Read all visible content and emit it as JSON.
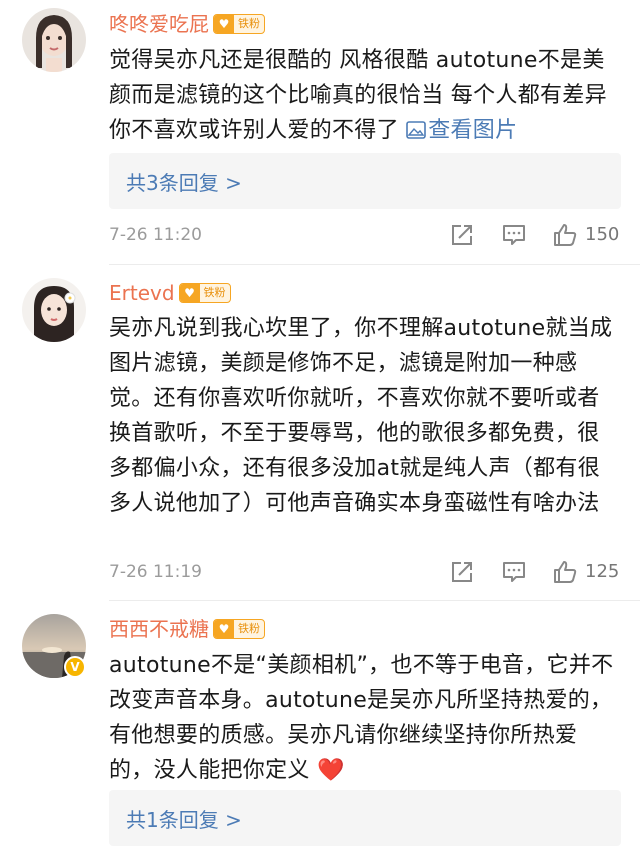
{
  "comments": [
    {
      "username": "咚咚爱吃屁",
      "fan_badge": "铁粉",
      "text": "觉得吴亦凡还是很酷的 风格很酷 autotune不是美颜而是滤镜的这个比喻真的很恰当 每个人都有差异 你不喜欢或许别人爱的不得了 ",
      "view_image": "查看图片",
      "reply_label": "共3条回复 >",
      "timestamp": "7-26 11:20",
      "likes": "150"
    },
    {
      "username": "Ertevd",
      "fan_badge": "铁粉",
      "text": "吴亦凡说到我心坎里了，你不理解autotune就当成图片滤镜，美颜是修饰不足，滤镜是附加一种感觉。还有你喜欢听你就听，不喜欢你就不要听或者换首歌听，不至于要辱骂，他的歌很多都免费，很多都偏小众，还有很多没加at就是纯人声（都有很多人说他加了）可他声音确实本身蛮磁性有啥办法",
      "timestamp": "7-26 11:19",
      "likes": "125"
    },
    {
      "username": "西西不戒糖",
      "fan_badge": "铁粉",
      "text": "autotune不是“美颜相机”，也不等于电音，它并不改变声音本身。autotune是吴亦凡所坚持热爱的，有他想要的质感。吴亦凡请你继续坚持你所热爱的，没人能把你定义",
      "emoji": "❤️",
      "reply_label": "共1条回复 >"
    }
  ],
  "icons": {
    "share": "share-icon",
    "comment": "comment-icon",
    "like": "like-icon",
    "image": "image-icon",
    "verified": "verified-badge-icon"
  },
  "colors": {
    "username": "#eb7350",
    "link": "#4c7bb5",
    "meta": "#9b9b9b",
    "fan_badge": "#f6a623",
    "verified": "#f7b500"
  }
}
